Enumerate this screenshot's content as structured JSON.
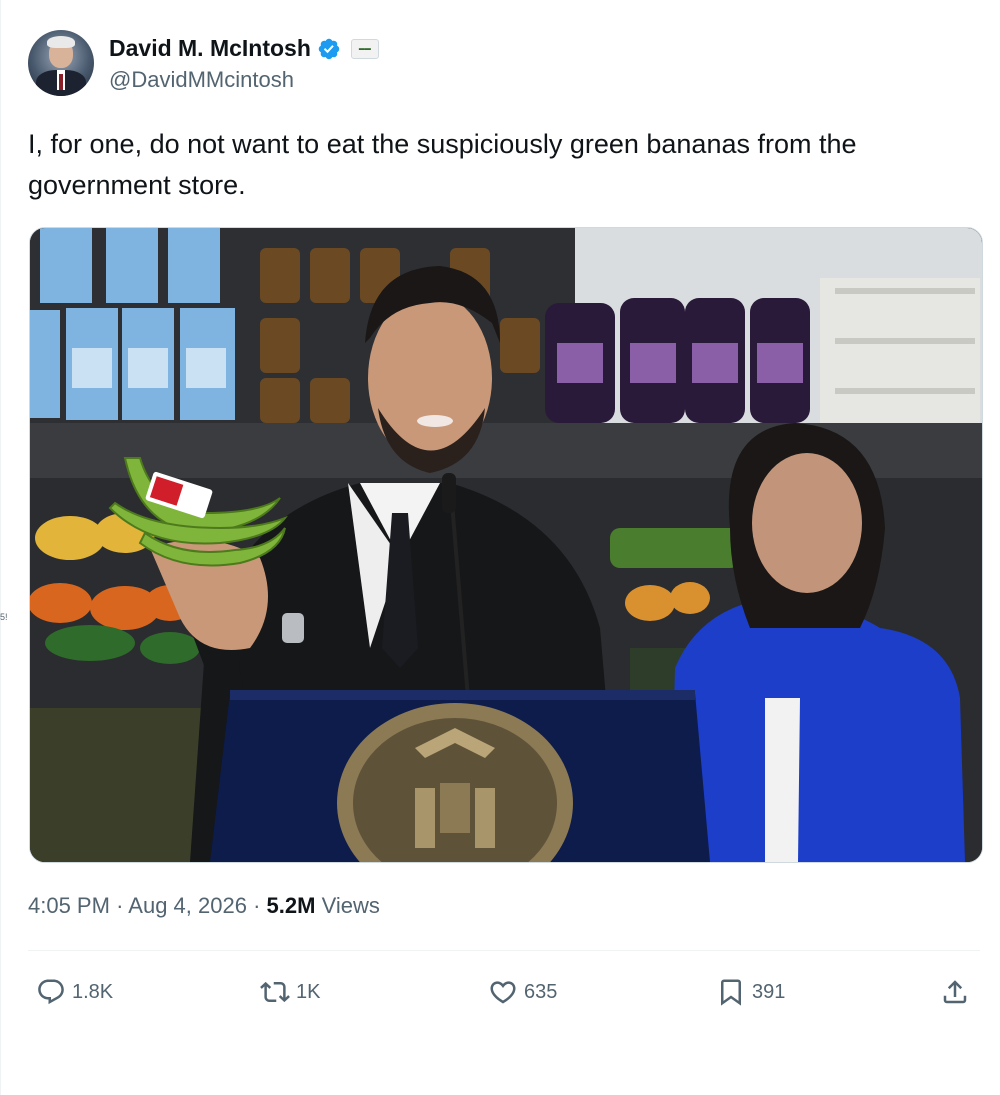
{
  "edge_text": "5!",
  "author": {
    "display_name": "David M. McIntosh",
    "handle": "@DavidMMcintosh",
    "verified_icon": "verified-badge-icon",
    "affiliation_icon": "club-for-growth-badge"
  },
  "tweet": {
    "text": "I, for one, do not want to eat the suspiciously green bananas from the government store."
  },
  "meta": {
    "time": "4:05 PM",
    "separator": "·",
    "date": "Aug 4, 2026",
    "views_count": "5.2M",
    "views_label": "Views"
  },
  "actions": {
    "reply": {
      "icon": "reply-icon",
      "count": "1.8K"
    },
    "repost": {
      "icon": "repost-icon",
      "count": "1K"
    },
    "like": {
      "icon": "heart-icon",
      "count": "635"
    },
    "bookmark": {
      "icon": "bookmark-icon",
      "count": "391"
    },
    "share": {
      "icon": "share-icon"
    }
  },
  "colors": {
    "text_primary": "#0f1419",
    "text_secondary": "#536471",
    "verified_blue": "#1d9bf0"
  }
}
